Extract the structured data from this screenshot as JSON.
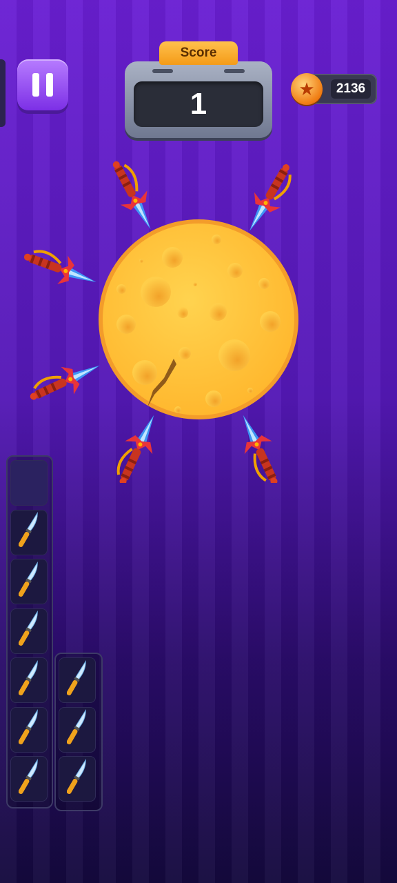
{
  "hud": {
    "score_label": "Score",
    "score_value": "1",
    "coins": "2136",
    "pause_icon": "pause-icon",
    "coin_icon": "star-coin-icon"
  },
  "target": {
    "type": "cheese-wheel",
    "stuck_knives": 6,
    "colors": {
      "cheese": "#ffc43d",
      "rim": "#f39c2a",
      "knife_handle": "#d63a2a",
      "blade": "#38a6ff"
    }
  },
  "knives_remaining": {
    "left_column_filled": 6,
    "left_column_empty": 1,
    "right_column_filled": 3
  },
  "colors": {
    "background_top": "#6a1fd3",
    "background_bottom": "#14093d",
    "pause_button": "#9a55f2",
    "score_tab": "#f7a824"
  }
}
